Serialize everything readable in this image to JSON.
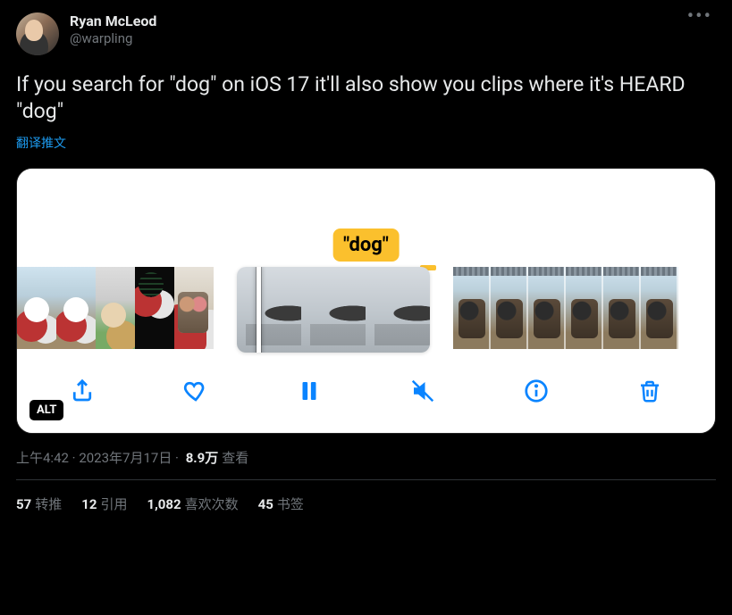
{
  "author": {
    "display_name": "Ryan McLeod",
    "handle": "@warpling"
  },
  "tweet": {
    "text": "If you search for \"dog\" on iOS 17 it'll also show you clips where it's HEARD \"dog\"",
    "translate_label": "翻译推文"
  },
  "media": {
    "search_token": "\"dog\"",
    "alt_badge": "ALT",
    "toolbar": {
      "share": "share",
      "like": "like",
      "pause": "pause",
      "mute": "mute",
      "info": "info",
      "trash": "trash"
    }
  },
  "meta": {
    "time": "上午4:42",
    "dot1": " · ",
    "date": "2023年7月17日",
    "dot2": " · ",
    "views_count": "8.9万",
    "views_label": "查看"
  },
  "stats": {
    "retweets": {
      "count": "57",
      "label": "转推"
    },
    "quotes": {
      "count": "12",
      "label": "引用"
    },
    "likes": {
      "count": "1,082",
      "label": "喜欢次数"
    },
    "bookmarks": {
      "count": "45",
      "label": "书签"
    }
  }
}
